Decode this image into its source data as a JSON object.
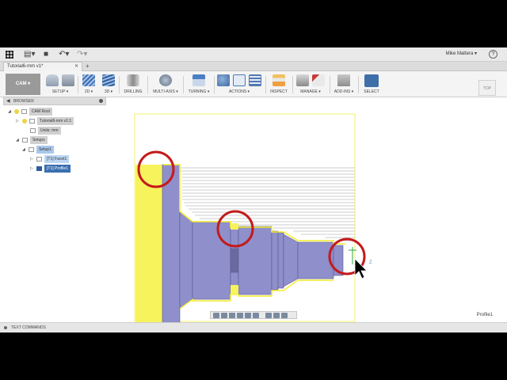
{
  "titlebar": {
    "user_name": "Mike Mattera ▾",
    "help_label": "?"
  },
  "tabs": {
    "document_title": "Tutorial6-mm v1*",
    "close_glyph": "✕",
    "add_glyph": "+"
  },
  "ribbon": {
    "workspace": "CAM ▾",
    "groups": {
      "setup": "SETUP ▾",
      "2d": "2D ▾",
      "3d": "3D ▾",
      "drilling": "DRILLING",
      "multi_axis": "MULTI-AXIS ▾",
      "turning": "TURNING ▾",
      "actions": "ACTIONS ▾",
      "inspect": "INSPECT",
      "manage": "MANAGE ▾",
      "add_ins": "ADD-INS ▾",
      "select": "SELECT"
    },
    "view_cube": "TOP"
  },
  "browser": {
    "title": "BROWSER",
    "tree": {
      "root": "CAM Root",
      "document": "Tutorial6-mm v1:1",
      "units": "Units: mm",
      "setups": "Setups",
      "setup1": "Setup1",
      "op1": "[T1] Facet1",
      "op2": "[T1] Profile1"
    }
  },
  "canvas": {
    "active_operation_label": "Profile1",
    "axis_label": "Z"
  },
  "bottom": {
    "text_commands": "TEXT COMMANDS"
  }
}
